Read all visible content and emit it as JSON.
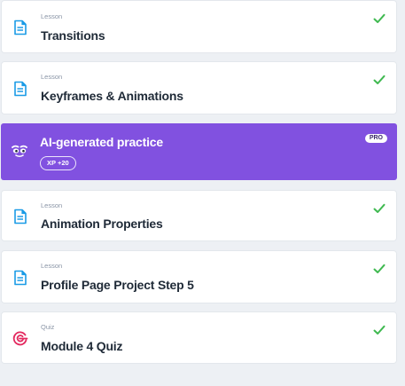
{
  "items": [
    {
      "type": "Lesson",
      "title": "Transitions",
      "icon": "document-icon",
      "completed": true
    },
    {
      "type": "Lesson",
      "title": "Keyframes & Animations",
      "icon": "document-icon",
      "completed": true
    },
    {
      "title": "AI-generated practice",
      "xp": "XP +20",
      "badge": "PRO",
      "icon": "ai-face-icon"
    },
    {
      "type": "Lesson",
      "title": "Animation Properties",
      "icon": "document-icon",
      "completed": true
    },
    {
      "type": "Lesson",
      "title": "Profile Page Project Step 5",
      "icon": "document-icon",
      "completed": true
    },
    {
      "type": "Quiz",
      "title": "Module 4 Quiz",
      "icon": "target-icon",
      "completed": true
    }
  ],
  "colors": {
    "background": "#edf0f4",
    "card": "#ffffff",
    "ai_card": "#8151e0",
    "check": "#3fb950",
    "lesson_icon": "#1a9be6",
    "quiz_icon": "#e3295f"
  }
}
